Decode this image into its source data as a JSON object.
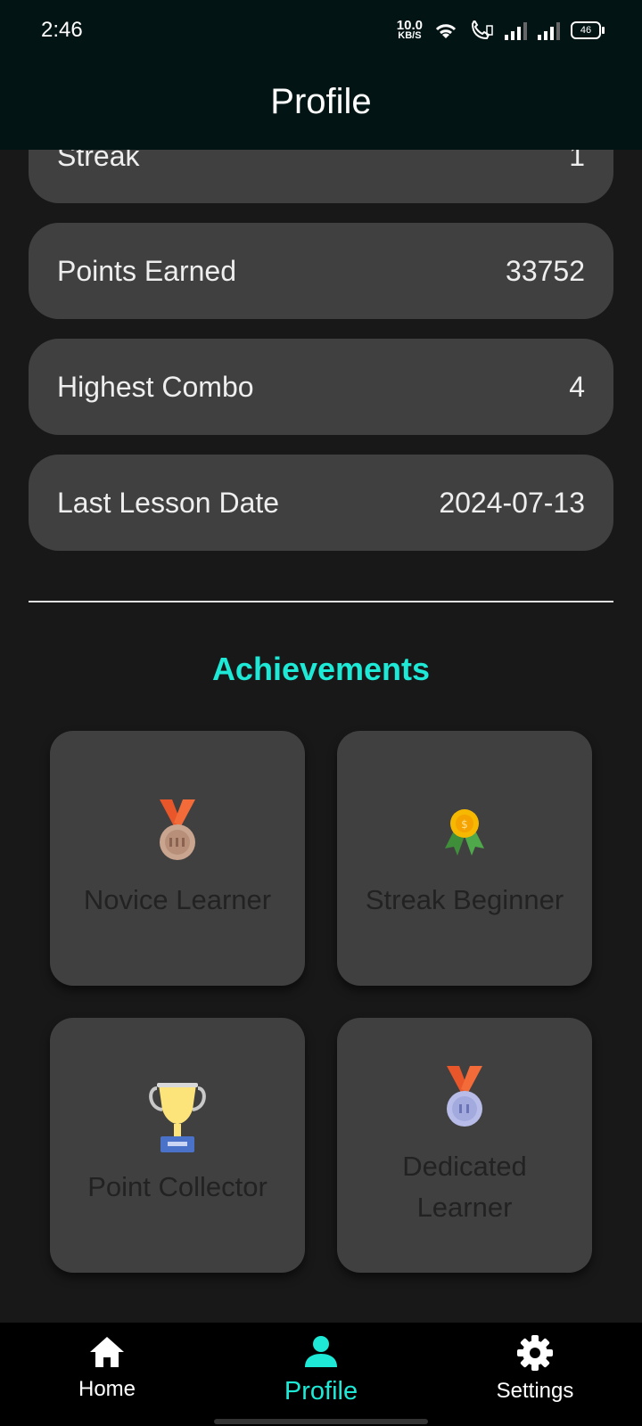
{
  "status_bar": {
    "time": "2:46",
    "net_speed_value": "10.0",
    "net_speed_unit": "KB/S",
    "battery": "46"
  },
  "app_bar": {
    "title": "Profile"
  },
  "stats": [
    {
      "label": "Streak",
      "value": "1"
    },
    {
      "label": "Points Earned",
      "value": "33752"
    },
    {
      "label": "Highest Combo",
      "value": "4"
    },
    {
      "label": "Last Lesson Date",
      "value": "2024-07-13"
    }
  ],
  "achievements": {
    "title": "Achievements",
    "items": [
      {
        "label": "Novice Learner",
        "icon": "bronze-medal-icon"
      },
      {
        "label": "Streak Beginner",
        "icon": "gold-rosette-icon"
      },
      {
        "label": "Point Collector",
        "icon": "trophy-icon"
      },
      {
        "label": "Dedicated Learner",
        "icon": "silver-medal-icon"
      }
    ]
  },
  "bottom_nav": {
    "items": [
      {
        "label": "Home",
        "icon": "home-icon"
      },
      {
        "label": "Profile",
        "icon": "person-icon",
        "active": true
      },
      {
        "label": "Settings",
        "icon": "gear-icon"
      }
    ]
  },
  "colors": {
    "accent": "#1de9d6",
    "background": "#181818",
    "card": "#404040",
    "app_bar": "#021414"
  }
}
